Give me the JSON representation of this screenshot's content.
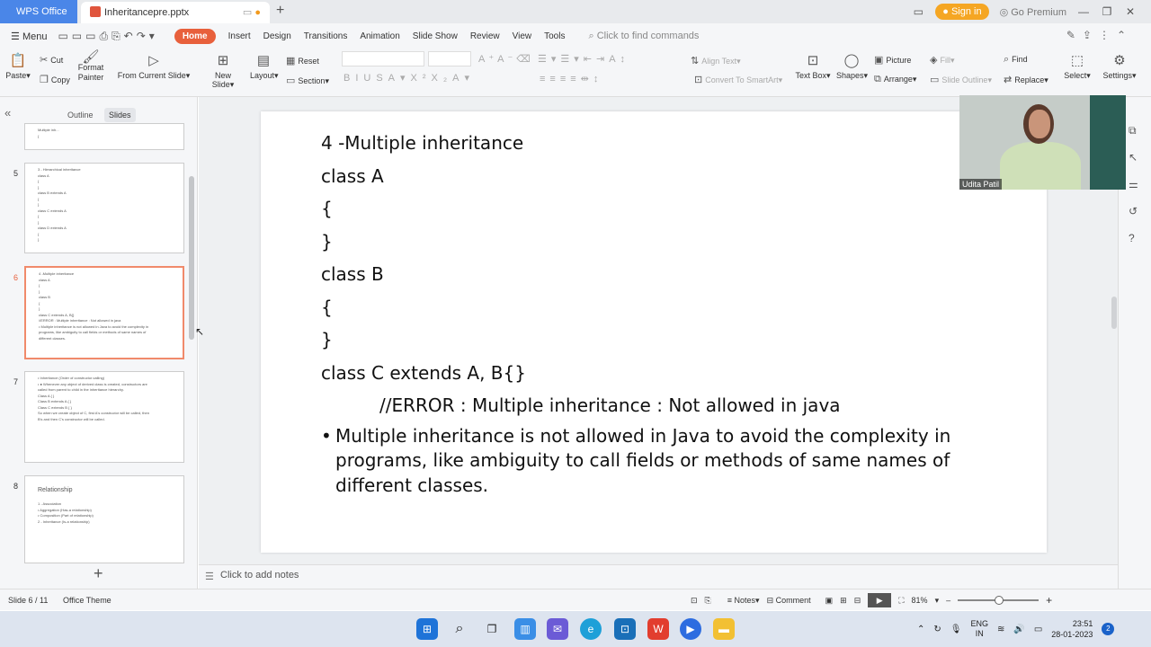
{
  "titlebar": {
    "app_tab": "WPS Office",
    "doc_tab": "Inheritancepre.pptx",
    "sign_in": "Sign in",
    "go_premium": "Go Premium"
  },
  "menubar": {
    "menu": "Menu",
    "tabs": [
      "Home",
      "Insert",
      "Design",
      "Transitions",
      "Animation",
      "Slide Show",
      "Review",
      "View",
      "Tools"
    ],
    "active_tab": "Home",
    "find_placeholder": "Click to find commands"
  },
  "ribbon": {
    "paste": "Paste",
    "cut": "Cut",
    "copy": "Copy",
    "format_painter_1": "Format",
    "format_painter_2": "Painter",
    "from_current": "From Current Slide",
    "new_slide": "New Slide",
    "layout": "Layout",
    "reset": "Reset",
    "section": "Section",
    "align_text": "Align Text",
    "convert_smartart": "Convert To SmartArt",
    "text_box": "Text Box",
    "shapes": "Shapes",
    "picture": "Picture",
    "fill": "Fill",
    "arrange": "Arrange",
    "slide_outline": "Slide Outline",
    "find": "Find",
    "replace": "Replace",
    "select": "Select",
    "settings": "Settings"
  },
  "panel": {
    "outline_tab": "Outline",
    "slides_tab": "Slides",
    "selected_slide": 6
  },
  "thumbnails": [
    {
      "num": "",
      "lines": [
        "Multiple inh...",
        "{"
      ]
    },
    {
      "num": "5",
      "lines": [
        "3 - Hierarchical inheritance",
        "class A",
        "{",
        "}",
        "class B extends A",
        "{",
        "}",
        "class C extends A",
        "{",
        "}",
        "class D extends A",
        "{",
        "}"
      ]
    },
    {
      "num": "6",
      "lines": [
        "4 -Multiple inheritance",
        "class A",
        "{",
        "}",
        "class B",
        "{",
        "}",
        "class C extends A, B{}",
        "       //ERROR : Multiple inheritance : Not allowed in java",
        "• Multiple inheritance is not allowed in Java to avoid the complexity in",
        "  programs, like ambiguity to call fields or methods of same names of",
        "  different classes."
      ]
    },
    {
      "num": "7",
      "lines": [
        "• Inheritance (Order of constructor calling)",
        "• ● Whenever any object of derived class is created, constructors are",
        "  called from parent to child in the inheritance hierarchy.",
        "Class A { }",
        "Class B extends A { }",
        "Class C extends B { }",
        "So when we create object of C, first A's constructor will be called, then",
        "B's and then C's constructor will be called."
      ]
    },
    {
      "num": "8",
      "lines": [
        "Relationship",
        "1 - Association",
        "• Aggregation (Has-a relationship)",
        "• Composition (Part of relationship)",
        "2 - Inheritance (Is-a relationship)"
      ]
    }
  ],
  "slide": {
    "lines": [
      "4 -Multiple inheritance",
      "class A",
      "{",
      "}",
      "class B",
      "{",
      "}",
      "class C extends A, B{}"
    ],
    "comment_line": "//ERROR : Multiple inheritance : Not allowed in java",
    "bullet": "Multiple inheritance is not allowed in Java to avoid the complexity in programs, like ambiguity to call fields or methods of same names of different classes."
  },
  "notes_placeholder": "Click to add notes",
  "webcam_label": "Udita Patil",
  "status": {
    "slide_count": "Slide 6 / 11",
    "theme": "Office Theme",
    "notes": "Notes",
    "comment": "Comment",
    "zoom": "81%"
  },
  "taskbar": {
    "lang_1": "ENG",
    "lang_2": "IN",
    "time": "23:51",
    "date": "28-01-2023",
    "notifications": "2"
  }
}
